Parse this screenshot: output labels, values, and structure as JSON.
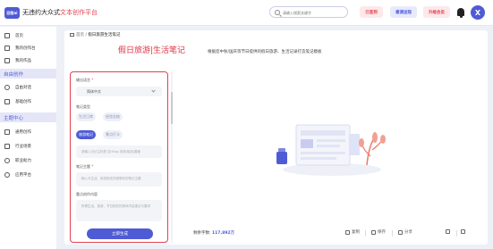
{
  "header": {
    "logo_text": "回答ai",
    "app_title_plain": "无违约大众式",
    "app_title_accent": "文本创作平台",
    "search_placeholder": "请输入搜索关键字",
    "signed_label": "已签到",
    "invite_label": "邀请送现",
    "upgrade_label": "升级会员",
    "avatar_initial": "X"
  },
  "sidebar": {
    "items_top": [
      {
        "label": "首页",
        "icon": "home-icon"
      },
      {
        "label": "我的创作台",
        "icon": "edit-icon"
      },
      {
        "label": "我的作品",
        "icon": "folder-icon"
      }
    ],
    "section1": "自由创作",
    "items_mid": [
      {
        "label": "自由对话",
        "icon": "chat-icon"
      },
      {
        "label": "基础创作",
        "icon": "pen-icon"
      }
    ],
    "section2": "主题中心",
    "items_bottom": [
      {
        "label": "通用创作",
        "icon": "grid-icon"
      },
      {
        "label": "行业场景",
        "icon": "briefcase-icon"
      },
      {
        "label": "职业助力",
        "icon": "user-icon"
      },
      {
        "label": "应用平台",
        "icon": "apps-icon"
      }
    ]
  },
  "breadcrumb": {
    "root": "首页",
    "separator": "/",
    "current": "假日旅游生活笔记"
  },
  "hero": {
    "title": "假日旅游|生活笔记",
    "description": "根据您中秋/国庆等节日提供的假日旅游、生活记录打造笔记模板"
  },
  "form": {
    "language_label": "输出语言",
    "language_value": "简体中文",
    "note_type_label": "笔记类型",
    "note_types": [
      "生活日常",
      "经验总结",
      "旅游笔记",
      "景点打卡"
    ],
    "active_note_type": "旅游笔记",
    "keyword_placeholder": "请输入日记主标签 如:Vlog 流浪/挑战/露营",
    "topic_label": "笔记主题",
    "topic_placeholder": "输入与生活、旅游相关的相想你的笔记主题",
    "content_label": "重点创作内容",
    "content_placeholder": "所需生活、旅游、节日相关的具体内容重点与要求",
    "generate_button": "立即生成"
  },
  "result": {
    "words_left_label": "剩余字数:",
    "words_left_value": "117,892万",
    "copy_label": "复制",
    "save_label": "保存",
    "share_label": "分享"
  },
  "colors": {
    "accent_blue": "#4f5bd5",
    "accent_red": "#e0414f"
  }
}
